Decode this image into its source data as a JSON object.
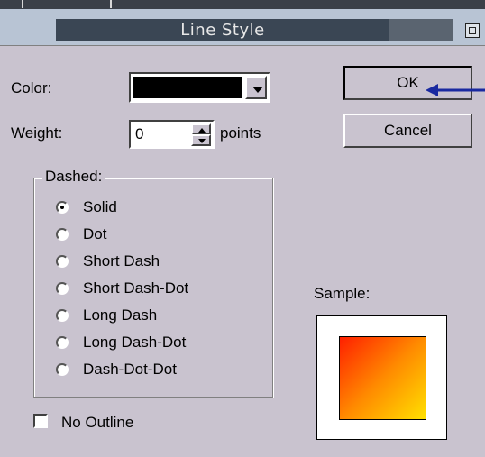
{
  "window": {
    "title": "Line Style"
  },
  "color": {
    "label": "Color:",
    "value": "#000000"
  },
  "weight": {
    "label": "Weight:",
    "value": "0",
    "unit": "points"
  },
  "buttons": {
    "ok": "OK",
    "cancel": "Cancel"
  },
  "dashed": {
    "label": "Dashed:",
    "selected": "Solid",
    "options": [
      "Solid",
      "Dot",
      "Short Dash",
      "Short Dash-Dot",
      "Long Dash",
      "Long Dash-Dot",
      "Dash-Dot-Dot"
    ]
  },
  "no_outline": {
    "label": "No Outline",
    "checked": false
  },
  "sample": {
    "label": "Sample:"
  },
  "colors": {
    "pointer_arrow": "#1a2aa0",
    "gradient_start": "#ff1f00",
    "gradient_end": "#ffe000"
  },
  "icons": {
    "combo_arrow": "chevron-down-icon",
    "pointer": "arrow-left-icon",
    "maximize": "maximize-icon"
  }
}
